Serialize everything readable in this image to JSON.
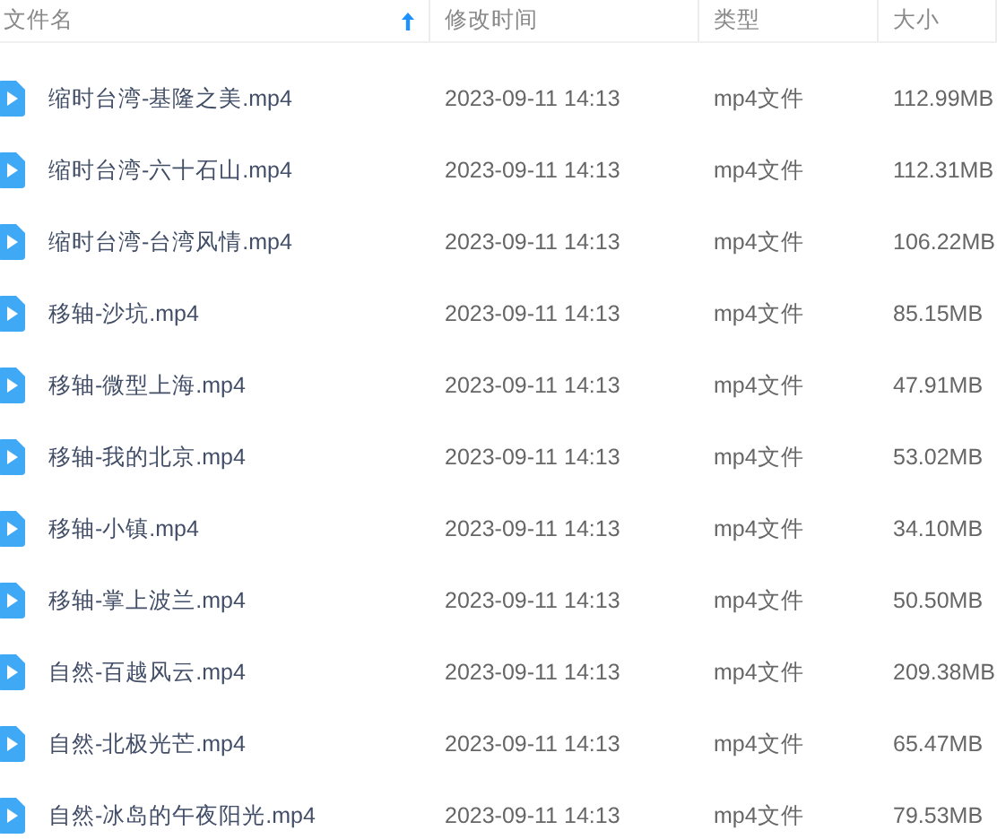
{
  "columns": [
    {
      "label": "文件名",
      "sorted": true
    },
    {
      "label": "修改时间",
      "sorted": false
    },
    {
      "label": "类型",
      "sorted": false
    },
    {
      "label": "大小",
      "sorted": false
    }
  ],
  "rows": [
    {
      "name": "缩时台湾-基隆之美.mp4",
      "modified": "2023-09-11 14:13",
      "type": "mp4文件",
      "size": "112.99MB"
    },
    {
      "name": "缩时台湾-六十石山.mp4",
      "modified": "2023-09-11 14:13",
      "type": "mp4文件",
      "size": "112.31MB"
    },
    {
      "name": "缩时台湾-台湾风情.mp4",
      "modified": "2023-09-11 14:13",
      "type": "mp4文件",
      "size": "106.22MB"
    },
    {
      "name": "移轴-沙坑.mp4",
      "modified": "2023-09-11 14:13",
      "type": "mp4文件",
      "size": "85.15MB"
    },
    {
      "name": "移轴-微型上海.mp4",
      "modified": "2023-09-11 14:13",
      "type": "mp4文件",
      "size": "47.91MB"
    },
    {
      "name": "移轴-我的北京.mp4",
      "modified": "2023-09-11 14:13",
      "type": "mp4文件",
      "size": "53.02MB"
    },
    {
      "name": "移轴-小镇.mp4",
      "modified": "2023-09-11 14:13",
      "type": "mp4文件",
      "size": "34.10MB"
    },
    {
      "name": "移轴-掌上波兰.mp4",
      "modified": "2023-09-11 14:13",
      "type": "mp4文件",
      "size": "50.50MB"
    },
    {
      "name": "自然-百越风云.mp4",
      "modified": "2023-09-11 14:13",
      "type": "mp4文件",
      "size": "209.38MB"
    },
    {
      "name": "自然-北极光芒.mp4",
      "modified": "2023-09-11 14:13",
      "type": "mp4文件",
      "size": "65.47MB"
    },
    {
      "name": "自然-冰岛的午夜阳光.mp4",
      "modified": "2023-09-11 14:13",
      "type": "mp4文件",
      "size": "79.53MB"
    }
  ]
}
